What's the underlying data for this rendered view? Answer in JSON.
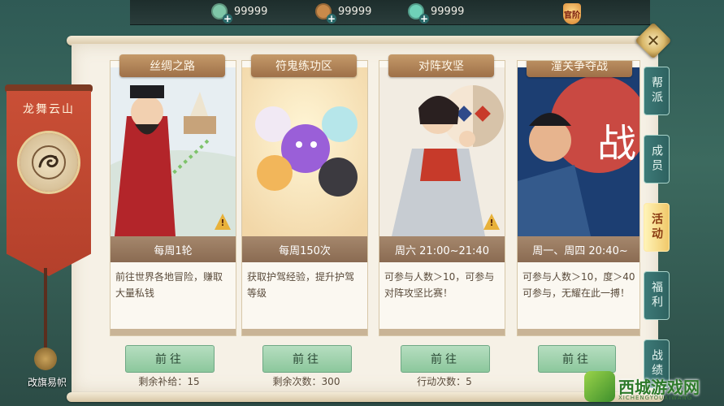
{
  "resources": [
    {
      "icon": "jade-coin-icon",
      "value": "99999",
      "color": "#7fc7a8"
    },
    {
      "icon": "copper-coin-icon",
      "value": "99999",
      "color": "#c98a4a"
    },
    {
      "icon": "jade-ring-icon",
      "value": "99999",
      "color": "#6fd1b8"
    }
  ],
  "badge_label": "官阶",
  "banner": {
    "title": "龙舞云山",
    "change_flag": "改旗易帜"
  },
  "cards": [
    {
      "title": "丝绸之路",
      "frequency": "每周1轮",
      "description": "前往世界各地冒险，赚取大量私钱",
      "button": "前往",
      "count": "剩余补给：15",
      "warning": true
    },
    {
      "title": "符鬼练功区",
      "frequency": "每周150次",
      "description": "获取护驾经验，提升护驾等级",
      "button": "前往",
      "count": "剩余次数：300",
      "warning": false
    },
    {
      "title": "对阵攻坚",
      "frequency": "周六 21:00~21:40",
      "description": "可参与人数＞10，可参与对阵攻坚比赛！",
      "button": "前往",
      "count": "行动次数：5",
      "warning": true
    },
    {
      "title": "潼关争夺战",
      "frequency": "周一、周四 20:40~",
      "description": "可参与人数＞10，度＞40可参与，无耀在此一搏！",
      "button": "前往",
      "count": "",
      "warning": false,
      "art_text": "战"
    }
  ],
  "side_tabs": [
    {
      "label": "帮派",
      "active": false
    },
    {
      "label": "成员",
      "active": false
    },
    {
      "label": "活动",
      "active": true
    },
    {
      "label": "福利",
      "active": false
    },
    {
      "label": "战绩",
      "active": false
    }
  ],
  "close_label": "✕",
  "watermark": {
    "text": "西城游戏网",
    "sub": "XICHENGYOUXIWANG"
  }
}
